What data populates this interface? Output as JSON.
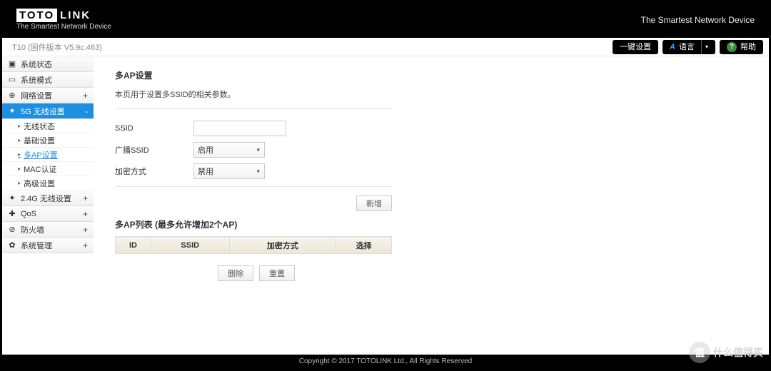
{
  "brand": {
    "logo_l": "TOTO",
    "logo_r": "LINK",
    "tagline": "The Smartest Network Device",
    "tag_right": "The Smartest Network Device"
  },
  "firmware": "T10 (固件版本 V5.9c.463)",
  "topbtns": {
    "oneclick": "一键设置",
    "lang": "语言",
    "help": "帮助"
  },
  "menu": {
    "items": [
      {
        "icon": "▣",
        "label": "系统状态"
      },
      {
        "icon": "▭",
        "label": "系统模式"
      },
      {
        "icon": "⊕",
        "label": "网络设置",
        "exp": "+"
      },
      {
        "icon": "✦",
        "label": "5G 无线设置",
        "exp": "-",
        "active": true
      }
    ],
    "sub": [
      {
        "label": "无线状态"
      },
      {
        "label": "基础设置"
      },
      {
        "label": "多AP设置",
        "on": true
      },
      {
        "label": "MAC认证"
      },
      {
        "label": "高级设置"
      }
    ],
    "items2": [
      {
        "icon": "✦",
        "label": "2.4G 无线设置",
        "exp": "+"
      },
      {
        "icon": "✚",
        "label": "QoS",
        "exp": "+"
      },
      {
        "icon": "⊘",
        "label": "防火墙",
        "exp": "+"
      },
      {
        "icon": "✿",
        "label": "系统管理",
        "exp": "+"
      }
    ]
  },
  "page": {
    "title": "多AP设置",
    "desc": "本页用于设置多SSID的相关参数。",
    "form": {
      "ssid_label": "SSID",
      "bcast_label": "广播SSID",
      "bcast_value": "启用",
      "enc_label": "加密方式",
      "enc_value": "禁用",
      "add_btn": "新增"
    },
    "table": {
      "title": "多AP列表 (最多允许增加2个AP)",
      "headers": {
        "id": "ID",
        "ssid": "SSID",
        "enc": "加密方式",
        "sel": "选择"
      }
    },
    "actions": {
      "del": "删除",
      "reset": "重置"
    }
  },
  "footer": "Copyright © 2017 TOTOLINK Ltd., All Rights Reserved",
  "watermark": {
    "c": "值",
    "t": "什么值得买"
  }
}
